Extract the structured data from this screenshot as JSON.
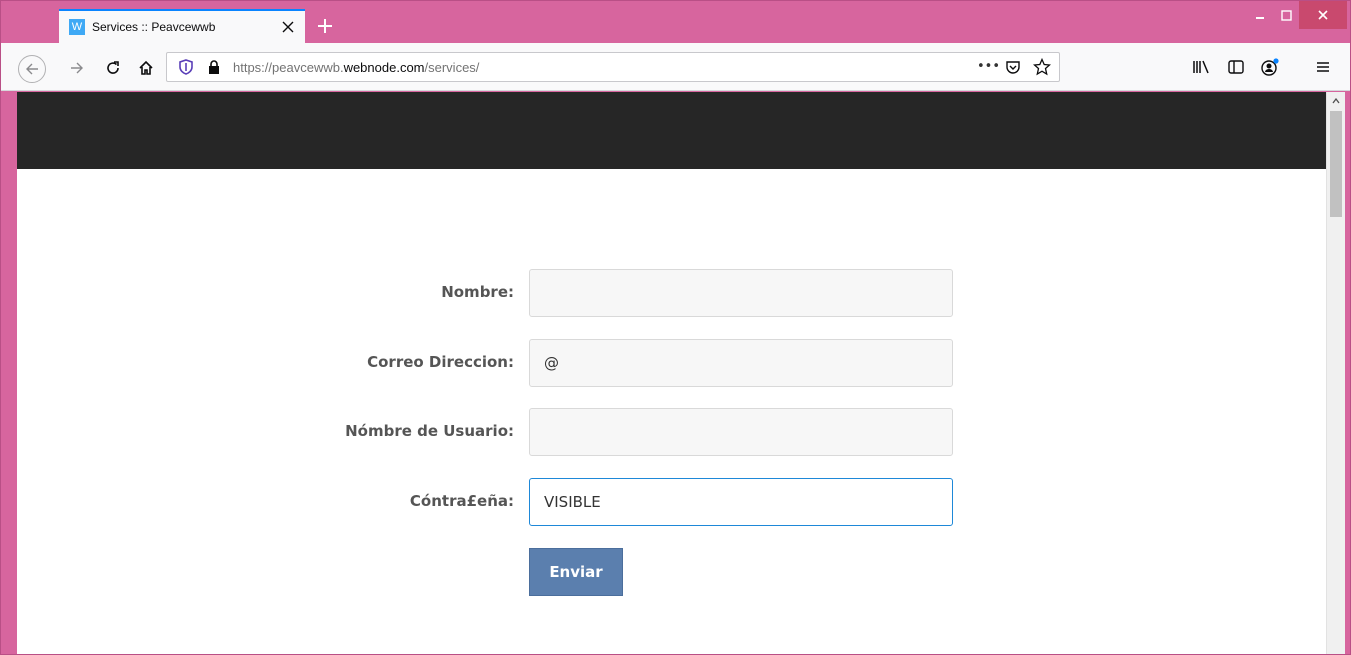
{
  "browser": {
    "tab": {
      "favicon_letter": "W",
      "title": "Services :: Peavcewwb"
    },
    "url": {
      "prefix": "https://peavcewwb.",
      "domain": "webnode.com",
      "path": "/services/"
    },
    "url_more": "•••"
  },
  "form": {
    "fields": [
      {
        "label": "Nombre:",
        "value": ""
      },
      {
        "label": "Correo Direccion:",
        "value": "@"
      },
      {
        "label": "Nómbre de Usuario:",
        "value": ""
      },
      {
        "label": "Cóntra£eña:",
        "value": "VISIBLE"
      }
    ],
    "submit_label": "Enviar"
  },
  "colors": {
    "window_frame": "#d7659e",
    "site_header": "#262626",
    "button": "#5b7fae",
    "focus_border": "#1e88d8"
  }
}
